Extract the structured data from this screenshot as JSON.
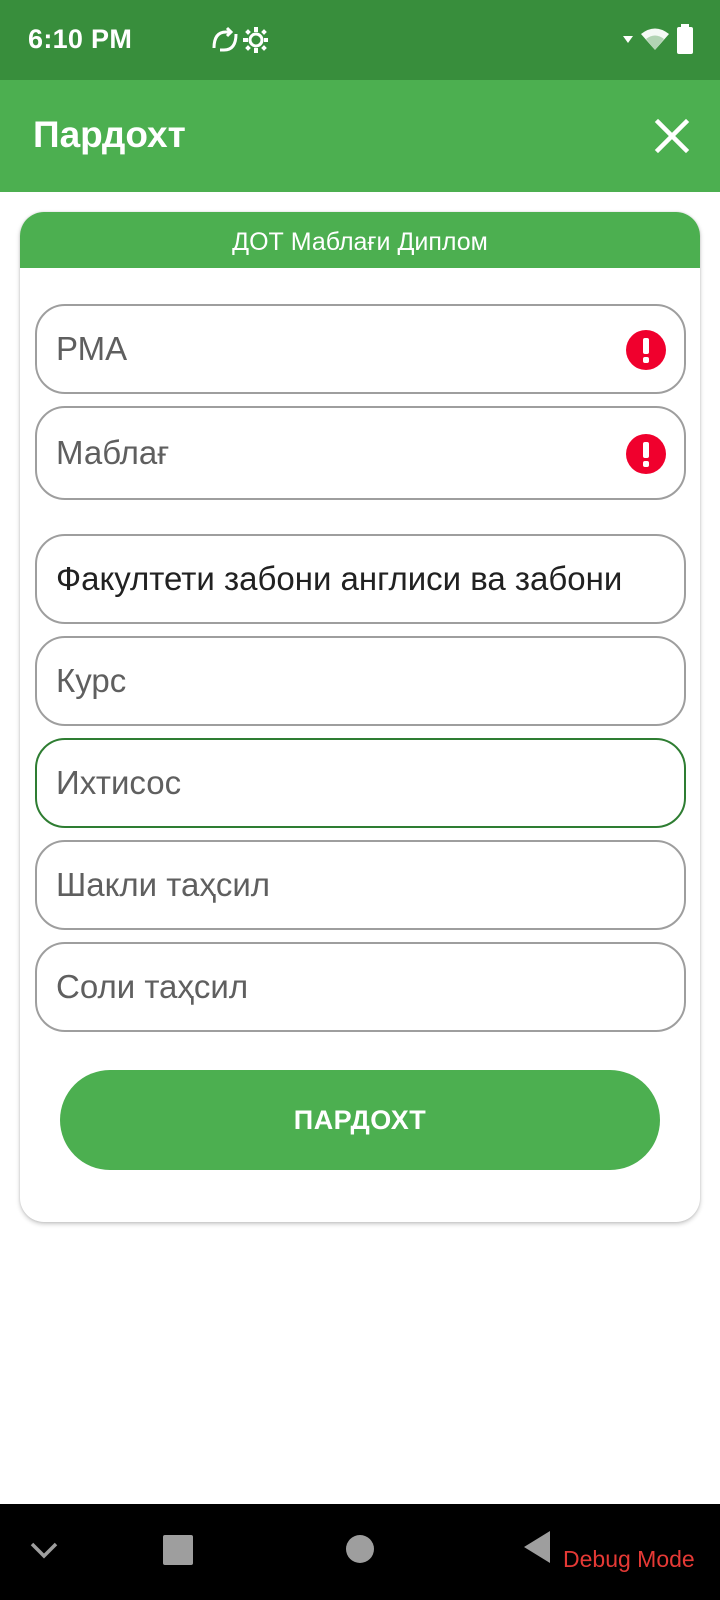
{
  "status_bar": {
    "time": "6:10 PM",
    "icons": [
      "notification-sync-icon",
      "notification-settings-icon",
      "wifi-icon",
      "battery-icon"
    ]
  },
  "app_bar": {
    "title": "Пардохт",
    "close_icon": "close-icon"
  },
  "card": {
    "header": "ДОТ Маблағи Диплом",
    "fields": [
      {
        "placeholder": "РМА",
        "value": "",
        "error": true
      },
      {
        "placeholder": "Маблағ",
        "value": "",
        "error": true
      },
      {
        "placeholder": "",
        "value": "Факултети забони англиси ва забони",
        "error": false
      },
      {
        "placeholder": "Курс",
        "value": "",
        "error": false
      },
      {
        "placeholder": "Ихтисос",
        "value": "",
        "error": false,
        "focused": true
      },
      {
        "placeholder": "Шакли таҳсил",
        "value": "",
        "error": false
      },
      {
        "placeholder": "Соли таҳсил",
        "value": "",
        "error": false
      }
    ],
    "submit_label": "ПАРДОХТ"
  },
  "nav_bar": {
    "debug_label": "Debug Mode"
  },
  "colors": {
    "status_bar": "#388e3c",
    "primary": "#4caf50",
    "error": "#f44336",
    "focused_border": "#2e7d32",
    "debug_text": "#e53935"
  }
}
